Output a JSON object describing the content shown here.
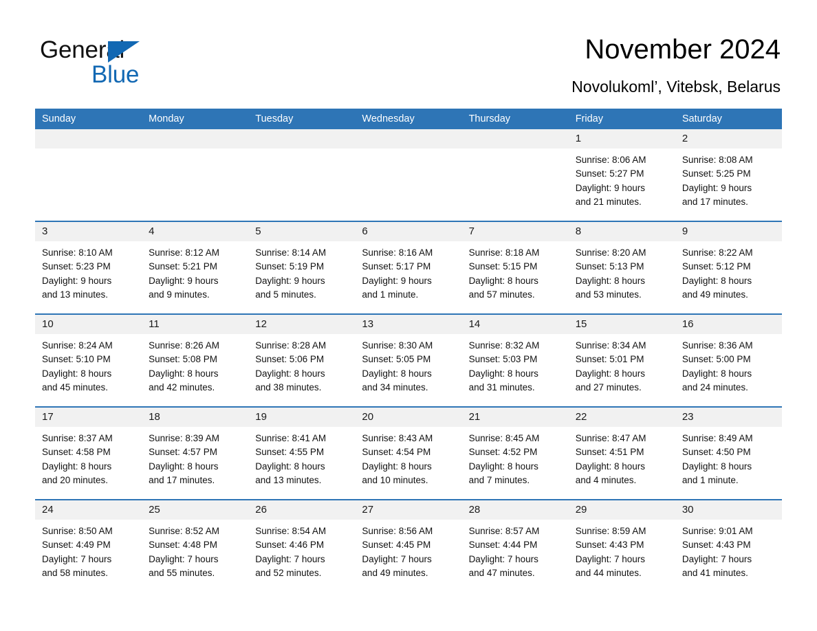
{
  "brand": {
    "name_part1": "General",
    "name_part2": "Blue",
    "accent_color": "#1268B3",
    "logo_icon": "triangle-flag-icon"
  },
  "header": {
    "title": "November 2024",
    "location": "Novolukoml’, Vitebsk, Belarus"
  },
  "calendar": {
    "header_bg": "#2E75B6",
    "date_band_bg": "#F1F1F1",
    "weekdays": [
      "Sunday",
      "Monday",
      "Tuesday",
      "Wednesday",
      "Thursday",
      "Friday",
      "Saturday"
    ],
    "weeks": [
      [
        {
          "day": "",
          "sunrise": "",
          "sunset": "",
          "daylight_line1": "",
          "daylight_line2": ""
        },
        {
          "day": "",
          "sunrise": "",
          "sunset": "",
          "daylight_line1": "",
          "daylight_line2": ""
        },
        {
          "day": "",
          "sunrise": "",
          "sunset": "",
          "daylight_line1": "",
          "daylight_line2": ""
        },
        {
          "day": "",
          "sunrise": "",
          "sunset": "",
          "daylight_line1": "",
          "daylight_line2": ""
        },
        {
          "day": "",
          "sunrise": "",
          "sunset": "",
          "daylight_line1": "",
          "daylight_line2": ""
        },
        {
          "day": "1",
          "sunrise": "Sunrise: 8:06 AM",
          "sunset": "Sunset: 5:27 PM",
          "daylight_line1": "Daylight: 9 hours",
          "daylight_line2": "and 21 minutes."
        },
        {
          "day": "2",
          "sunrise": "Sunrise: 8:08 AM",
          "sunset": "Sunset: 5:25 PM",
          "daylight_line1": "Daylight: 9 hours",
          "daylight_line2": "and 17 minutes."
        }
      ],
      [
        {
          "day": "3",
          "sunrise": "Sunrise: 8:10 AM",
          "sunset": "Sunset: 5:23 PM",
          "daylight_line1": "Daylight: 9 hours",
          "daylight_line2": "and 13 minutes."
        },
        {
          "day": "4",
          "sunrise": "Sunrise: 8:12 AM",
          "sunset": "Sunset: 5:21 PM",
          "daylight_line1": "Daylight: 9 hours",
          "daylight_line2": "and 9 minutes."
        },
        {
          "day": "5",
          "sunrise": "Sunrise: 8:14 AM",
          "sunset": "Sunset: 5:19 PM",
          "daylight_line1": "Daylight: 9 hours",
          "daylight_line2": "and 5 minutes."
        },
        {
          "day": "6",
          "sunrise": "Sunrise: 8:16 AM",
          "sunset": "Sunset: 5:17 PM",
          "daylight_line1": "Daylight: 9 hours",
          "daylight_line2": "and 1 minute."
        },
        {
          "day": "7",
          "sunrise": "Sunrise: 8:18 AM",
          "sunset": "Sunset: 5:15 PM",
          "daylight_line1": "Daylight: 8 hours",
          "daylight_line2": "and 57 minutes."
        },
        {
          "day": "8",
          "sunrise": "Sunrise: 8:20 AM",
          "sunset": "Sunset: 5:13 PM",
          "daylight_line1": "Daylight: 8 hours",
          "daylight_line2": "and 53 minutes."
        },
        {
          "day": "9",
          "sunrise": "Sunrise: 8:22 AM",
          "sunset": "Sunset: 5:12 PM",
          "daylight_line1": "Daylight: 8 hours",
          "daylight_line2": "and 49 minutes."
        }
      ],
      [
        {
          "day": "10",
          "sunrise": "Sunrise: 8:24 AM",
          "sunset": "Sunset: 5:10 PM",
          "daylight_line1": "Daylight: 8 hours",
          "daylight_line2": "and 45 minutes."
        },
        {
          "day": "11",
          "sunrise": "Sunrise: 8:26 AM",
          "sunset": "Sunset: 5:08 PM",
          "daylight_line1": "Daylight: 8 hours",
          "daylight_line2": "and 42 minutes."
        },
        {
          "day": "12",
          "sunrise": "Sunrise: 8:28 AM",
          "sunset": "Sunset: 5:06 PM",
          "daylight_line1": "Daylight: 8 hours",
          "daylight_line2": "and 38 minutes."
        },
        {
          "day": "13",
          "sunrise": "Sunrise: 8:30 AM",
          "sunset": "Sunset: 5:05 PM",
          "daylight_line1": "Daylight: 8 hours",
          "daylight_line2": "and 34 minutes."
        },
        {
          "day": "14",
          "sunrise": "Sunrise: 8:32 AM",
          "sunset": "Sunset: 5:03 PM",
          "daylight_line1": "Daylight: 8 hours",
          "daylight_line2": "and 31 minutes."
        },
        {
          "day": "15",
          "sunrise": "Sunrise: 8:34 AM",
          "sunset": "Sunset: 5:01 PM",
          "daylight_line1": "Daylight: 8 hours",
          "daylight_line2": "and 27 minutes."
        },
        {
          "day": "16",
          "sunrise": "Sunrise: 8:36 AM",
          "sunset": "Sunset: 5:00 PM",
          "daylight_line1": "Daylight: 8 hours",
          "daylight_line2": "and 24 minutes."
        }
      ],
      [
        {
          "day": "17",
          "sunrise": "Sunrise: 8:37 AM",
          "sunset": "Sunset: 4:58 PM",
          "daylight_line1": "Daylight: 8 hours",
          "daylight_line2": "and 20 minutes."
        },
        {
          "day": "18",
          "sunrise": "Sunrise: 8:39 AM",
          "sunset": "Sunset: 4:57 PM",
          "daylight_line1": "Daylight: 8 hours",
          "daylight_line2": "and 17 minutes."
        },
        {
          "day": "19",
          "sunrise": "Sunrise: 8:41 AM",
          "sunset": "Sunset: 4:55 PM",
          "daylight_line1": "Daylight: 8 hours",
          "daylight_line2": "and 13 minutes."
        },
        {
          "day": "20",
          "sunrise": "Sunrise: 8:43 AM",
          "sunset": "Sunset: 4:54 PM",
          "daylight_line1": "Daylight: 8 hours",
          "daylight_line2": "and 10 minutes."
        },
        {
          "day": "21",
          "sunrise": "Sunrise: 8:45 AM",
          "sunset": "Sunset: 4:52 PM",
          "daylight_line1": "Daylight: 8 hours",
          "daylight_line2": "and 7 minutes."
        },
        {
          "day": "22",
          "sunrise": "Sunrise: 8:47 AM",
          "sunset": "Sunset: 4:51 PM",
          "daylight_line1": "Daylight: 8 hours",
          "daylight_line2": "and 4 minutes."
        },
        {
          "day": "23",
          "sunrise": "Sunrise: 8:49 AM",
          "sunset": "Sunset: 4:50 PM",
          "daylight_line1": "Daylight: 8 hours",
          "daylight_line2": "and 1 minute."
        }
      ],
      [
        {
          "day": "24",
          "sunrise": "Sunrise: 8:50 AM",
          "sunset": "Sunset: 4:49 PM",
          "daylight_line1": "Daylight: 7 hours",
          "daylight_line2": "and 58 minutes."
        },
        {
          "day": "25",
          "sunrise": "Sunrise: 8:52 AM",
          "sunset": "Sunset: 4:48 PM",
          "daylight_line1": "Daylight: 7 hours",
          "daylight_line2": "and 55 minutes."
        },
        {
          "day": "26",
          "sunrise": "Sunrise: 8:54 AM",
          "sunset": "Sunset: 4:46 PM",
          "daylight_line1": "Daylight: 7 hours",
          "daylight_line2": "and 52 minutes."
        },
        {
          "day": "27",
          "sunrise": "Sunrise: 8:56 AM",
          "sunset": "Sunset: 4:45 PM",
          "daylight_line1": "Daylight: 7 hours",
          "daylight_line2": "and 49 minutes."
        },
        {
          "day": "28",
          "sunrise": "Sunrise: 8:57 AM",
          "sunset": "Sunset: 4:44 PM",
          "daylight_line1": "Daylight: 7 hours",
          "daylight_line2": "and 47 minutes."
        },
        {
          "day": "29",
          "sunrise": "Sunrise: 8:59 AM",
          "sunset": "Sunset: 4:43 PM",
          "daylight_line1": "Daylight: 7 hours",
          "daylight_line2": "and 44 minutes."
        },
        {
          "day": "30",
          "sunrise": "Sunrise: 9:01 AM",
          "sunset": "Sunset: 4:43 PM",
          "daylight_line1": "Daylight: 7 hours",
          "daylight_line2": "and 41 minutes."
        }
      ]
    ]
  }
}
